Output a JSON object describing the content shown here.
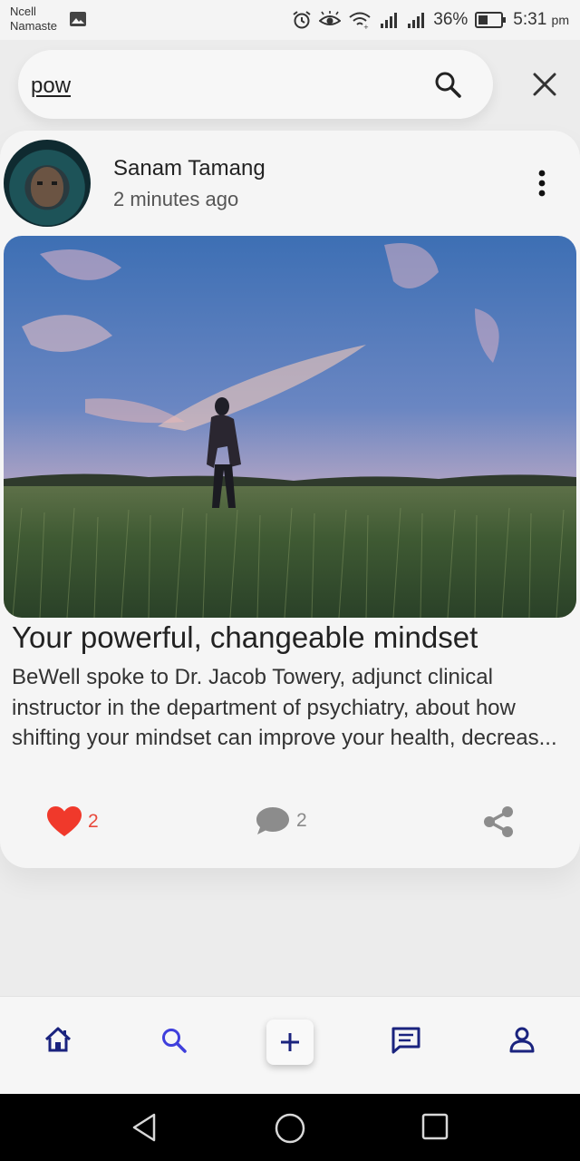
{
  "status_bar": {
    "carrier": "Ncell",
    "carrier_sub": "Namaste",
    "battery": "36%",
    "time": "5:31",
    "ampm": "pm"
  },
  "search": {
    "query": "pow"
  },
  "post": {
    "author": "Sanam Tamang",
    "time_ago": "2 minutes ago",
    "title": "Your powerful, changeable mindset",
    "excerpt": "BeWell spoke to Dr. Jacob Towery, adjunct clinical instructor in the department of psychiatry, about how shifting your mindset can improve your health, decreas...",
    "likes": "2",
    "comments": "2"
  },
  "nav": {
    "items": [
      "home-icon",
      "search-icon",
      "add-icon",
      "chat-icon",
      "profile-icon"
    ]
  },
  "colors": {
    "like": "#e84a3c",
    "nav_icon": "#1a237e",
    "nav_active": "#3f3fdc"
  }
}
